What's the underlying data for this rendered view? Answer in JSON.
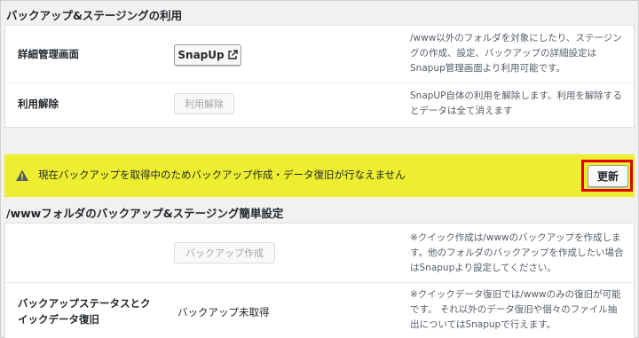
{
  "section1": {
    "title": "バックアップ&ステージングの利用",
    "rows": [
      {
        "label": "詳細管理画面",
        "button": "SnapUp",
        "button_icon": "external-link-icon",
        "desc": [
          "/www以外のフォルダを対象にしたり、ステージン",
          "グの作成、設定、バックアップの詳細設定は",
          "Snapup管理画面より利用可能です。"
        ]
      },
      {
        "label": "利用解除",
        "button": "利用解除",
        "desc": [
          "SnapUP自体の利用を解除します。利用を解除する",
          "とデータは全て消えます"
        ]
      }
    ]
  },
  "notice": {
    "icon": "warning-icon",
    "text": "現在バックアップを取得中のためバックアップ作成・データ復旧が行なえません",
    "button": "更新",
    "highlight_color": "#e00000",
    "bg_color": "#eeee30"
  },
  "section2": {
    "title": "/wwwフォルダのバックアップ&ステージング簡単設定",
    "rows": [
      {
        "button": "バックアップ作成",
        "desc": [
          "※クイック作成は/wwwのバックアップを作成しま",
          "す。他のフォルダのバックアップを作成したい場合",
          "はSnapupより設定してください。"
        ]
      },
      {
        "label": [
          "バックアップステータスとク",
          "イックデータ復旧"
        ],
        "value": "バックアップ未取得",
        "desc": [
          "※クイックデータ復旧では/wwwのみの復旧が可能",
          "です。 それ以外のデータ復旧や個々のファイル抽",
          "出についてはSnapupで行えます。"
        ]
      }
    ]
  }
}
